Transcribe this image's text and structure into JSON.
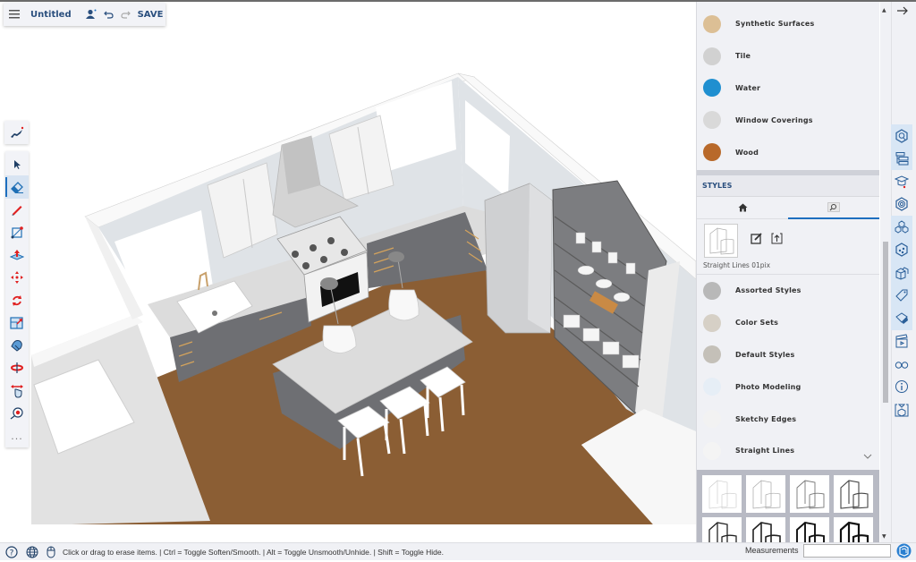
{
  "app": {
    "document_title": "Untitled",
    "save_label": "SAVE"
  },
  "colors": {
    "accent": "#1e6fbf",
    "title_blue": "#2a4f7e",
    "floor": "#8b5e34",
    "cabinet": "#6e6f73",
    "wall": "#e3e3e3",
    "red_tool": "#e02020"
  },
  "topbar": {
    "icons": [
      "menu-icon",
      "add-user-icon",
      "undo-icon",
      "redo-icon"
    ]
  },
  "toolbar": {
    "tools": [
      {
        "name": "select",
        "icon": "select-arrow-icon"
      },
      {
        "name": "eraser",
        "icon": "eraser-icon",
        "active": true
      },
      {
        "name": "line",
        "icon": "pencil-icon"
      },
      {
        "name": "rectangle",
        "icon": "rectangle-icon"
      },
      {
        "name": "push-pull",
        "icon": "push-pull-icon"
      },
      {
        "name": "move",
        "icon": "move-icon"
      },
      {
        "name": "rotate",
        "icon": "rotate-icon"
      },
      {
        "name": "scale",
        "icon": "scale-icon"
      },
      {
        "name": "paint-bucket",
        "icon": "paint-bucket-icon"
      },
      {
        "name": "orbit",
        "icon": "orbit-icon"
      },
      {
        "name": "pan",
        "icon": "pan-icon"
      },
      {
        "name": "tape-measure",
        "icon": "tape-measure-icon"
      }
    ],
    "more_label": "..."
  },
  "materials": {
    "items": [
      {
        "label": "Synthetic Surfaces",
        "color": "#dcbf95"
      },
      {
        "label": "Tile",
        "color": "#d1d1d1"
      },
      {
        "label": "Water",
        "color": "#1f8fd0"
      },
      {
        "label": "Window Coverings",
        "color": "#d9d9d9"
      },
      {
        "label": "Wood",
        "color": "#b8692a"
      }
    ]
  },
  "styles": {
    "header": "STYLES",
    "tabs": [
      {
        "icon": "home-icon",
        "active": false
      },
      {
        "icon": "browse-icon",
        "active": true
      }
    ],
    "current_style": "Straight Lines 01pix",
    "collections": [
      {
        "label": "Assorted Styles"
      },
      {
        "label": "Color Sets"
      },
      {
        "label": "Default Styles"
      },
      {
        "label": "Photo Modeling"
      },
      {
        "label": "Sketchy Edges"
      },
      {
        "label": "Straight Lines",
        "expanded": true
      }
    ],
    "thumbnail_count": 8
  },
  "tray": {
    "collapse_icon": "arrow-right-icon",
    "icons": [
      {
        "name": "entity-info-icon",
        "selected": true
      },
      {
        "name": "outliner-icon",
        "selected": true
      },
      {
        "name": "instructor-icon",
        "selected": false
      },
      {
        "name": "components-icon",
        "selected": false
      },
      {
        "name": "materials-icon",
        "selected": true
      },
      {
        "name": "styles-icon",
        "selected": true
      },
      {
        "name": "3d-warehouse-icon",
        "selected": true
      },
      {
        "name": "tags-icon",
        "selected": true
      },
      {
        "name": "soften-edges-icon",
        "selected": true
      },
      {
        "name": "scenes-icon",
        "selected": false
      },
      {
        "name": "display-icon",
        "selected": false
      },
      {
        "name": "model-info-icon",
        "selected": false
      },
      {
        "name": "solid-inspector-icon",
        "selected": false
      }
    ]
  },
  "status": {
    "hint": "Click or drag to erase items. | Ctrl = Toggle Soften/Smooth. | Alt = Toggle Unsmooth/Unhide. | Shift = Toggle Hide.",
    "measurements_label": "Measurements",
    "measurements_value": ""
  }
}
